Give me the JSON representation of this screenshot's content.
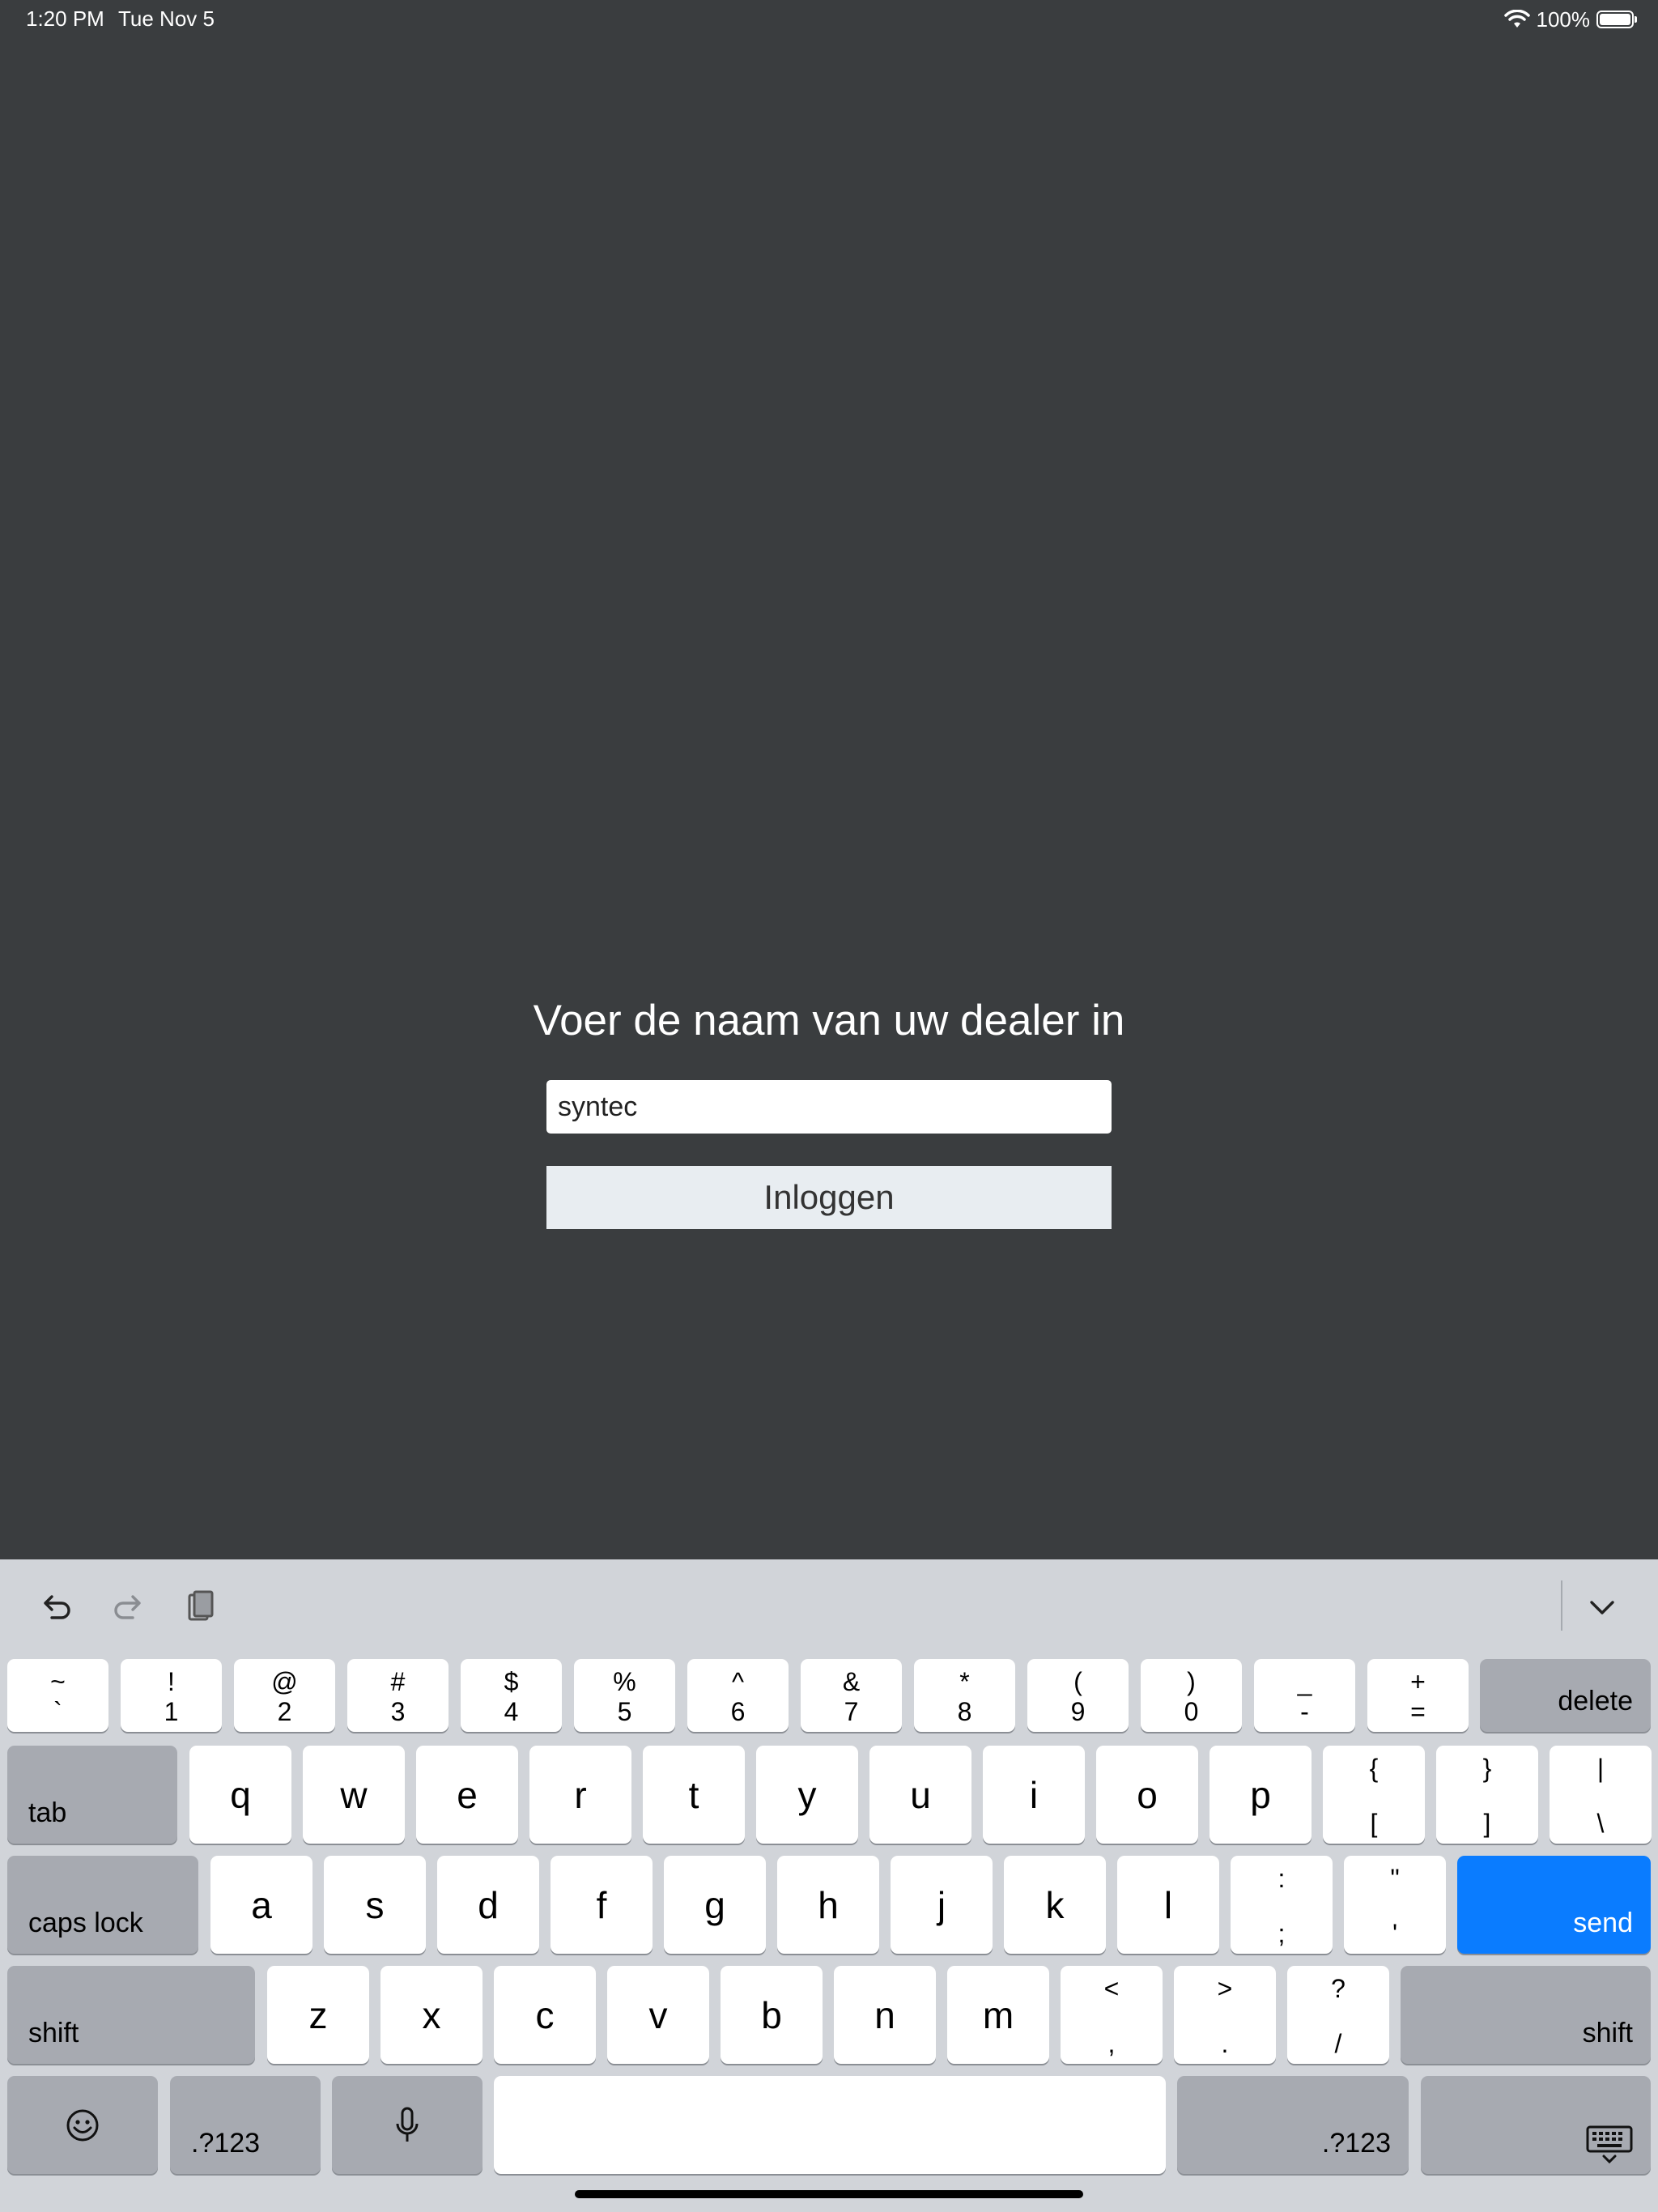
{
  "status_bar": {
    "time": "1:20 PM",
    "date": "Tue Nov 5",
    "battery": "100%",
    "battery_level": 1.0
  },
  "login": {
    "title": "Voer de naam van uw dealer in",
    "dealer_input_value": "syntec",
    "login_button": "Inloggen"
  },
  "keyboard": {
    "toolbar": {
      "undo": "undo-icon",
      "redo": "redo-icon",
      "paste": "paste-icon",
      "dismiss": "chevron-down-icon"
    },
    "row1": [
      {
        "top": "~",
        "bot": "`"
      },
      {
        "top": "!",
        "bot": "1"
      },
      {
        "top": "@",
        "bot": "2"
      },
      {
        "top": "#",
        "bot": "3"
      },
      {
        "top": "$",
        "bot": "4"
      },
      {
        "top": "%",
        "bot": "5"
      },
      {
        "top": "^",
        "bot": "6"
      },
      {
        "top": "&",
        "bot": "7"
      },
      {
        "top": "*",
        "bot": "8"
      },
      {
        "top": "(",
        "bot": "9"
      },
      {
        "top": ")",
        "bot": "0"
      },
      {
        "top": "_",
        "bot": "-"
      },
      {
        "top": "+",
        "bot": "="
      }
    ],
    "delete": "delete",
    "tab": "tab",
    "row2": [
      "q",
      "w",
      "e",
      "r",
      "t",
      "y",
      "u",
      "i",
      "o",
      "p"
    ],
    "row2_symbols": [
      {
        "top": "{",
        "bot": "["
      },
      {
        "top": "}",
        "bot": "]"
      },
      {
        "top": "|",
        "bot": "\\"
      }
    ],
    "caps_lock": "caps lock",
    "row3": [
      "a",
      "s",
      "d",
      "f",
      "g",
      "h",
      "j",
      "k",
      "l"
    ],
    "row3_symbols": [
      {
        "top": ":",
        "bot": ";"
      },
      {
        "top": "\"",
        "bot": "'"
      }
    ],
    "send": "send",
    "shift_left": "shift",
    "row4": [
      "z",
      "x",
      "c",
      "v",
      "b",
      "n",
      "m"
    ],
    "row4_symbols": [
      {
        "top": "<",
        "bot": ","
      },
      {
        "top": ">",
        "bot": "."
      },
      {
        "top": "?",
        "bot": "/"
      }
    ],
    "shift_right": "shift",
    "numbers_left": ".?123",
    "numbers_right": ".?123",
    "emoji": "emoji-icon",
    "mic": "microphone-icon",
    "keyboard_hide": "keyboard-icon"
  }
}
